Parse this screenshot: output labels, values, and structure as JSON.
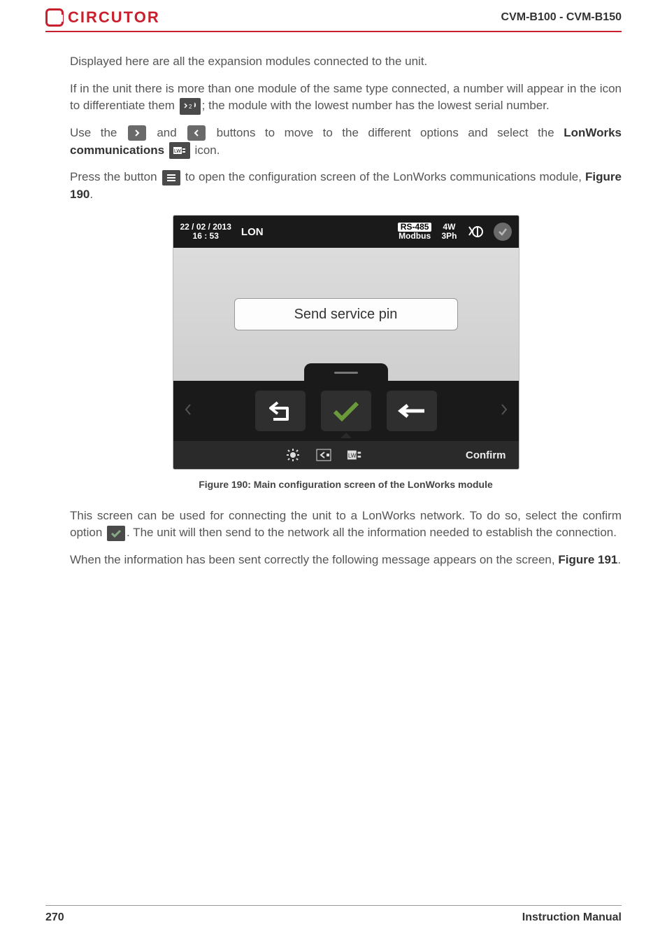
{
  "header": {
    "brand": "CIRCUTOR",
    "doc_id": "CVM-B100 - CVM-B150"
  },
  "body": {
    "p1": "Displayed here are all the expansion modules connected to the unit.",
    "p2a": "If in the unit there is more than one module of the same type connected, a number will appear in the icon to differentiate them ",
    "p2b": "; the module with the lowest number has the lowest serial number.",
    "p3a": "Use the ",
    "p3b": " and ",
    "p3c": " buttons to move to the different options and select the ",
    "p3d": "LonWorks communications",
    "p3e": " icon.",
    "p4a": "Press the button ",
    "p4b": " to open the configuration screen of the LonWorks communications module, ",
    "p4c": "Figure 190",
    "p4d": ".",
    "caption": "Figure 190: Main configuration screen of the LonWorks module",
    "p5a": "This screen can be used for connecting the unit to a LonWorks network. To do so, select the confirm option ",
    "p5b": ". The unit will then send to the network all the information needed to establish the connection.",
    "p6a": "When the information has been sent correctly the following message appears on the screen, ",
    "p6b": "Figure 191",
    "p6c": "."
  },
  "device": {
    "date": "22 / 02 / 2013",
    "time": "16 : 53",
    "mode": "LON",
    "proto_top": "RS-485",
    "proto_bot": "Modbus",
    "wiring_top": "4W",
    "wiring_bot": "3Ph",
    "main_button": "Send service pin",
    "footer_confirm": "Confirm"
  },
  "footer": {
    "page": "270",
    "label": "Instruction Manual"
  }
}
